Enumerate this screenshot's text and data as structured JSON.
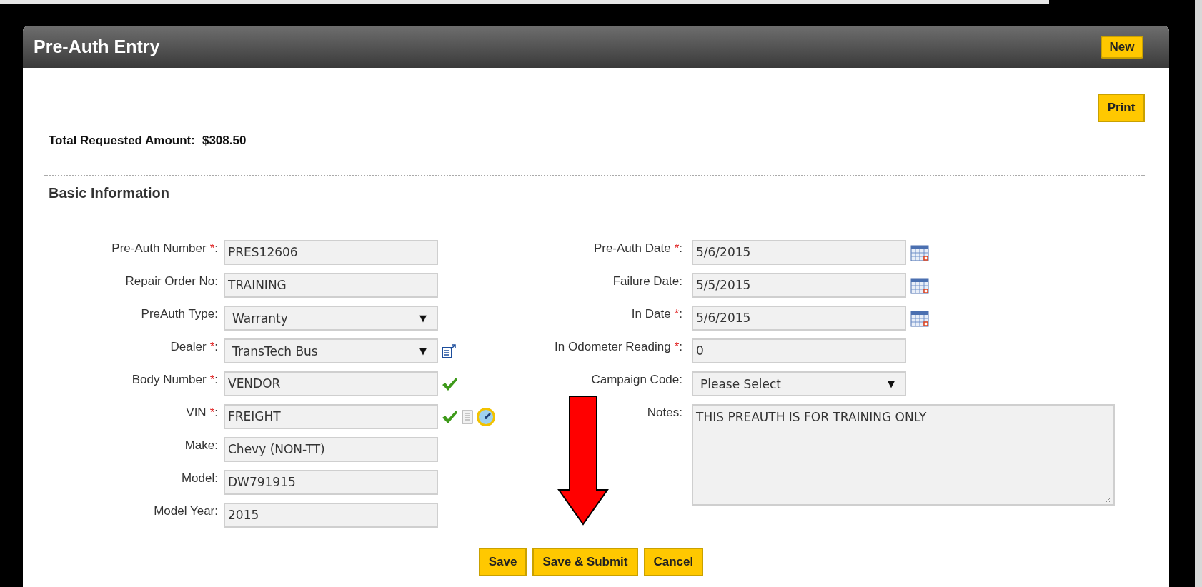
{
  "panel": {
    "title": "Pre-Auth Entry",
    "header_button": "New"
  },
  "print_button": "Print",
  "total": {
    "label": "Total Requested Amount:",
    "value": "$308.50"
  },
  "section_title": "Basic Information",
  "left_fields": [
    {
      "label": "Pre-Auth Number",
      "mark": "*",
      "suffix": ":",
      "kind": "text",
      "value": "PRES12606"
    },
    {
      "label": "Repair Order No",
      "suffix": ":",
      "kind": "text",
      "value": "TRAINING"
    },
    {
      "label": "PreAuth Type",
      "suffix": ":",
      "kind": "select",
      "value": "Warranty",
      "caret": "▼"
    },
    {
      "label": "Dealer",
      "mark": "*",
      "suffix": ":",
      "kind": "select",
      "value": "TransTech Bus",
      "caret": "▼",
      "addons": [
        {
          "kind": "edit"
        }
      ]
    },
    {
      "label": "Body Number",
      "mark": "*",
      "suffix": ":",
      "kind": "text",
      "value": "VENDOR",
      "addons": [
        {
          "kind": "check"
        }
      ]
    },
    {
      "label": "VIN",
      "mark": "*",
      "suffix": ":",
      "kind": "text",
      "value": "FREIGHT",
      "addons": [
        {
          "kind": "check"
        },
        {
          "kind": "document"
        },
        {
          "kind": "gauge"
        }
      ]
    },
    {
      "label": "Make",
      "suffix": ":",
      "kind": "text",
      "value": "Chevy (NON-TT)"
    },
    {
      "label": "Model",
      "suffix": ":",
      "kind": "text",
      "value": "DW791915"
    },
    {
      "label": "Model Year",
      "suffix": ":",
      "kind": "text",
      "value": "2015"
    }
  ],
  "right_fields": [
    {
      "label": "Pre-Auth Date",
      "mark": "*",
      "suffix": ":",
      "kind": "text",
      "value": "5/6/2015",
      "addons": [
        {
          "kind": "calendar"
        }
      ]
    },
    {
      "label": "Failure Date",
      "suffix": ":",
      "kind": "text",
      "value": "5/5/2015",
      "addons": [
        {
          "kind": "calendar"
        }
      ]
    },
    {
      "label": "In Date",
      "mark": "*",
      "suffix": ":",
      "kind": "text",
      "value": "5/6/2015",
      "addons": [
        {
          "kind": "calendar"
        }
      ]
    },
    {
      "label": "In Odometer Reading",
      "mark": "*",
      "suffix": ":",
      "kind": "text",
      "value": "0"
    },
    {
      "label": "Campaign Code",
      "suffix": ":",
      "kind": "select",
      "value": "Please Select",
      "caret": "▼"
    },
    {
      "label": "Notes",
      "suffix": ":",
      "kind": "textarea",
      "value": "THIS PREAUTH IS FOR TRAINING ONLY"
    }
  ],
  "buttons": [
    "Save",
    "Save & Submit",
    "Cancel"
  ],
  "annotation": {
    "kind": "down-arrow"
  }
}
